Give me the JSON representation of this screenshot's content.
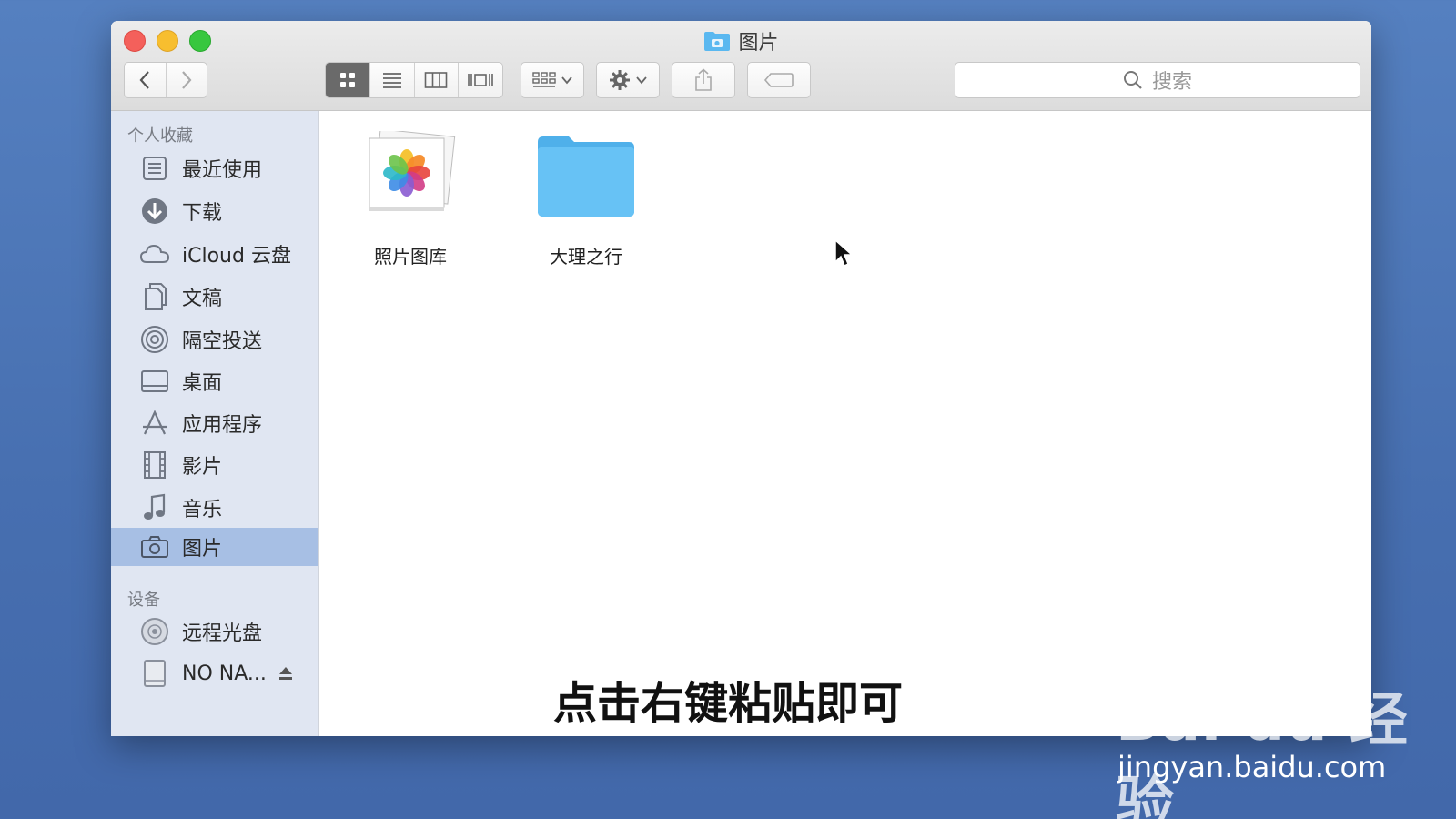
{
  "window": {
    "title": "图片"
  },
  "toolbar": {
    "search_placeholder": "搜索"
  },
  "sidebar": {
    "favorites_header": "个人收藏",
    "items": [
      {
        "label": "最近使用",
        "icon": "recents-icon"
      },
      {
        "label": "下载",
        "icon": "downloads-icon"
      },
      {
        "label": "iCloud 云盘",
        "icon": "icloud-icon"
      },
      {
        "label": "文稿",
        "icon": "documents-icon"
      },
      {
        "label": "隔空投送",
        "icon": "airdrop-icon"
      },
      {
        "label": "桌面",
        "icon": "desktop-icon"
      },
      {
        "label": "应用程序",
        "icon": "applications-icon"
      },
      {
        "label": "影片",
        "icon": "movies-icon"
      },
      {
        "label": "音乐",
        "icon": "music-icon"
      },
      {
        "label": "图片",
        "icon": "pictures-icon",
        "selected": true
      }
    ],
    "devices_header": "设备",
    "devices": [
      {
        "label": "远程光盘",
        "icon": "remote-disc-icon"
      },
      {
        "label": "NO NA...",
        "icon": "drive-icon",
        "ejectable": true
      }
    ]
  },
  "content": {
    "files": [
      {
        "label": "照片图库",
        "icon": "photos-library-icon"
      },
      {
        "label": "大理之行",
        "icon": "folder-icon"
      }
    ]
  },
  "overlay": {
    "subtitle": "点击右键粘贴即可",
    "watermark_logo": "Bai du 经验",
    "watermark_url": "jingyan.baidu.com"
  },
  "colors": {
    "desktop": "#4a78b8",
    "sidebar": "#e0e6f2",
    "selection": "#a7bfe4",
    "folder": "#5ab8f0"
  }
}
